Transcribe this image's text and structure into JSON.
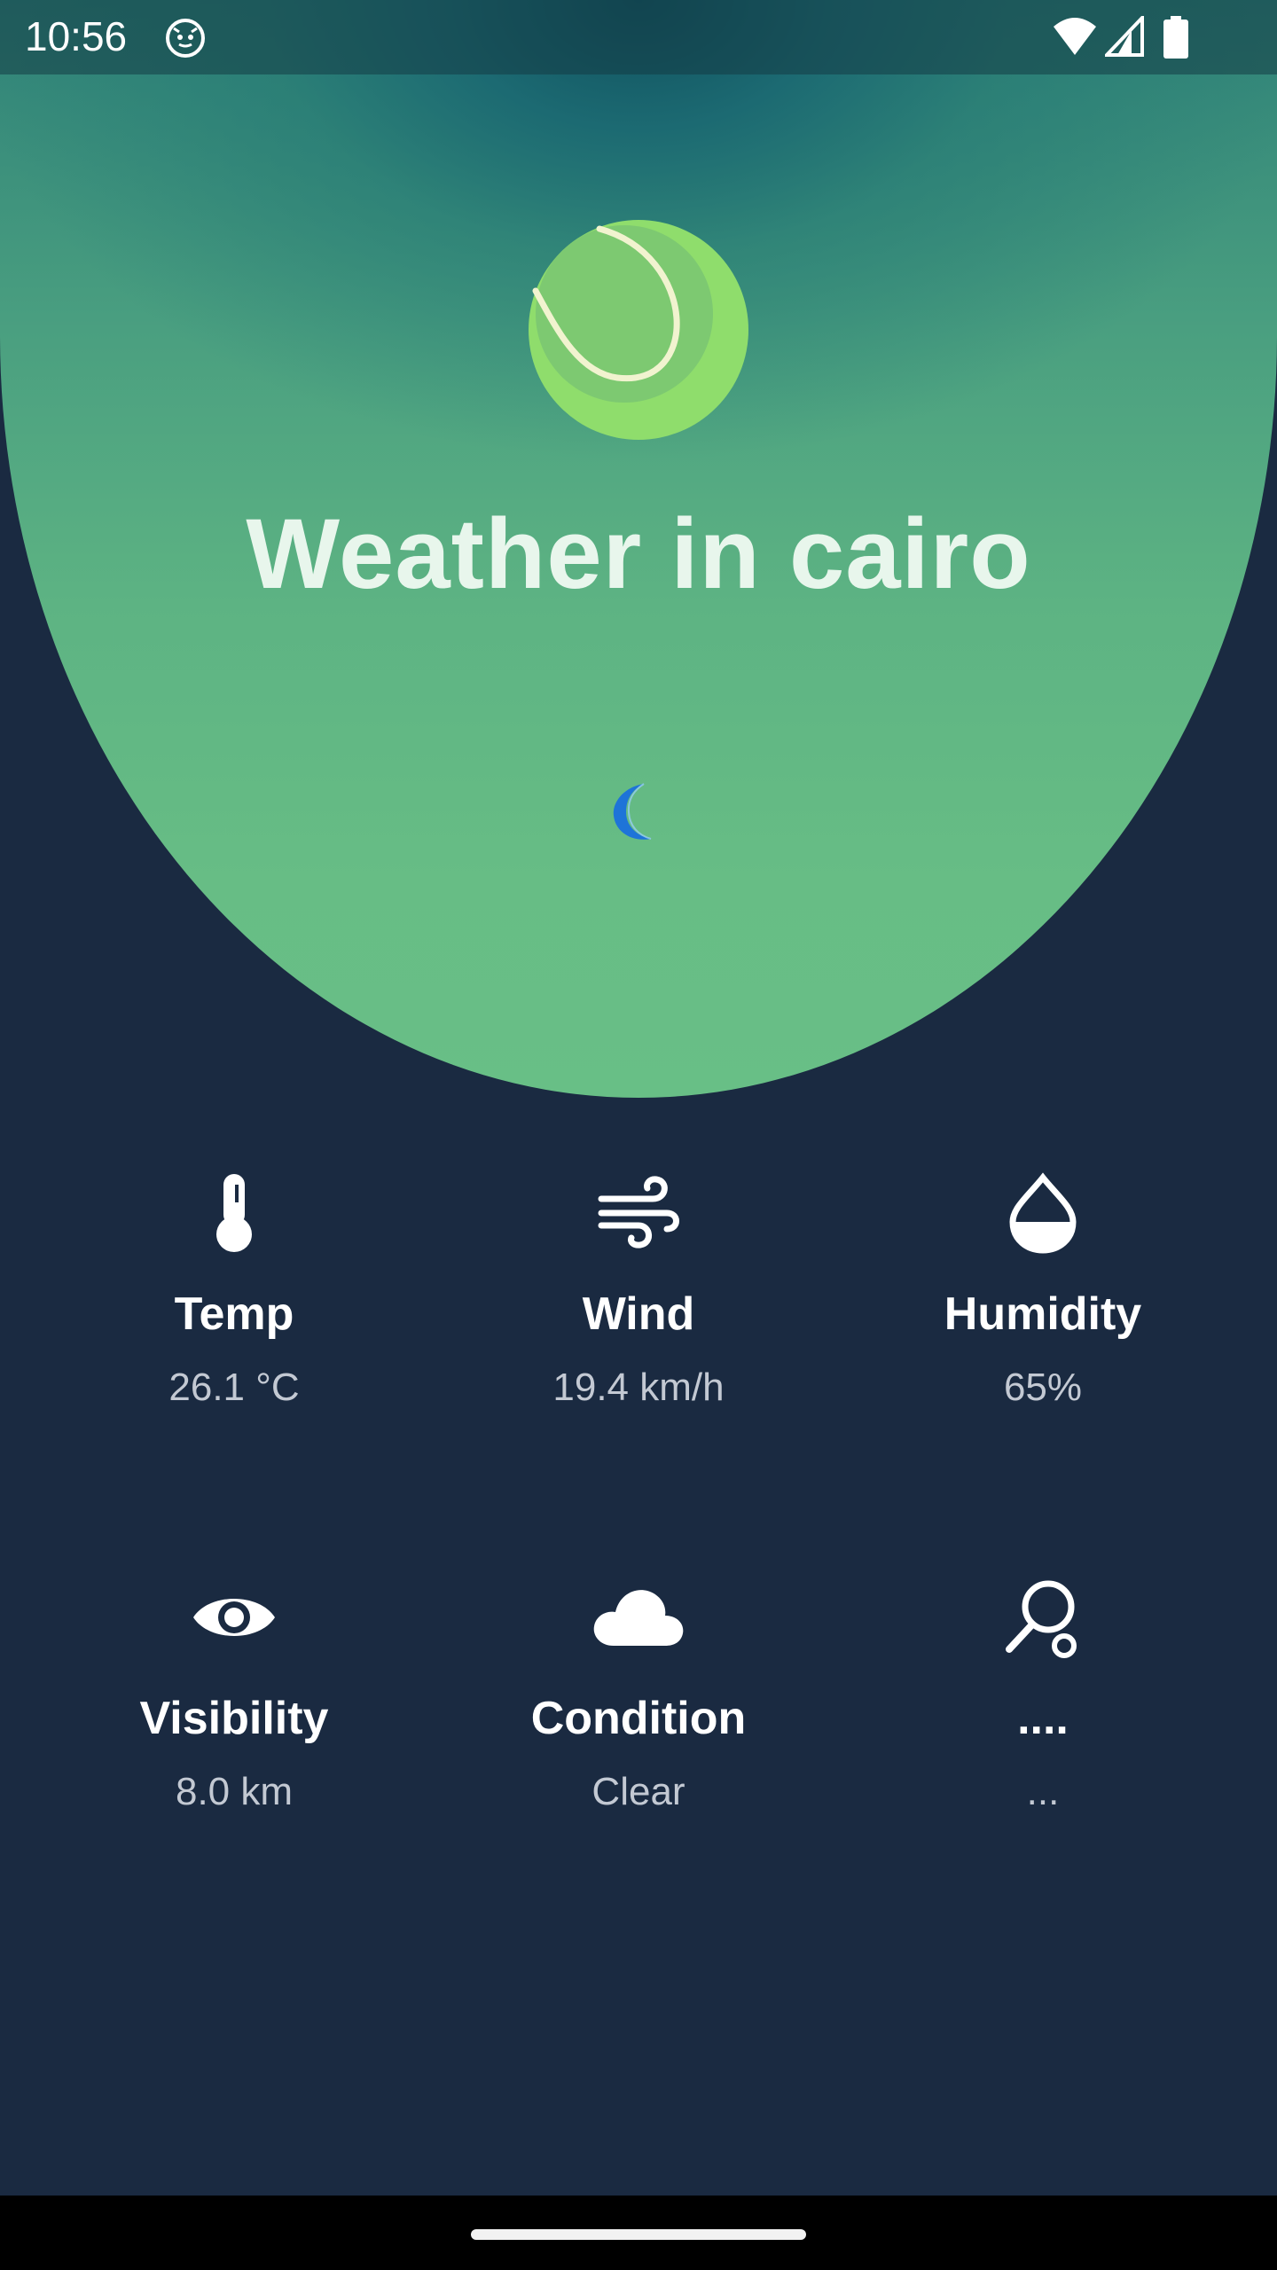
{
  "status_bar": {
    "time": "10:56"
  },
  "header": {
    "title": "Weather in cairo"
  },
  "colors": {
    "background": "#1a2a41",
    "hero_green": "#68bf86",
    "moon_blue": "#1e74d8"
  },
  "stats": [
    {
      "label": "Temp",
      "value": "26.1 °C",
      "icon": "thermometer-icon"
    },
    {
      "label": "Wind",
      "value": "19.4 km/h",
      "icon": "wind-icon"
    },
    {
      "label": "Humidity",
      "value": "65%",
      "icon": "humidity-drop-icon"
    },
    {
      "label": "Visibility",
      "value": "8.0 km",
      "icon": "eye-icon"
    },
    {
      "label": "Condition",
      "value": "Clear",
      "icon": "cloud-icon"
    },
    {
      "label": "....",
      "value": "...",
      "icon": "sports-racket-icon"
    }
  ]
}
